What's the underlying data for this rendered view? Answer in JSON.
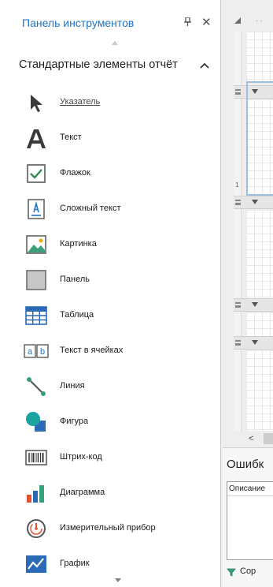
{
  "toolbox": {
    "title": "Панель инструментов",
    "pin_glyph": "ᵽ",
    "close_glyph": "✕",
    "group_label": "Стандартные элементы отчёт",
    "items": [
      {
        "label": "Указатель",
        "icon": "pointer-icon"
      },
      {
        "label": "Текст",
        "icon": "text-icon"
      },
      {
        "label": "Флажок",
        "icon": "checkbox-icon"
      },
      {
        "label": "Сложный текст",
        "icon": "rich-text-icon"
      },
      {
        "label": "Картинка",
        "icon": "picture-icon"
      },
      {
        "label": "Панель",
        "icon": "panel-icon"
      },
      {
        "label": "Таблица",
        "icon": "table-icon"
      },
      {
        "label": "Текст в ячейках",
        "icon": "cell-text-icon"
      },
      {
        "label": "Линия",
        "icon": "line-icon"
      },
      {
        "label": "Фигура",
        "icon": "shape-icon"
      },
      {
        "label": "Штрих-код",
        "icon": "barcode-icon"
      },
      {
        "label": "Диаграмма",
        "icon": "chart-icon"
      },
      {
        "label": "Измерительный прибор",
        "icon": "gauge-icon"
      },
      {
        "label": "График",
        "icon": "sparkline-icon"
      }
    ]
  },
  "designer": {
    "ruler_number": "1",
    "ruler_bottom_number": "1",
    "hscroll_left_glyph": "<"
  },
  "errors": {
    "title": "Ошибк",
    "column_description": "Описание",
    "button_label": "Сор"
  },
  "colors": {
    "accent": "#1e73c8",
    "selection_border": "#9fbfe0"
  }
}
